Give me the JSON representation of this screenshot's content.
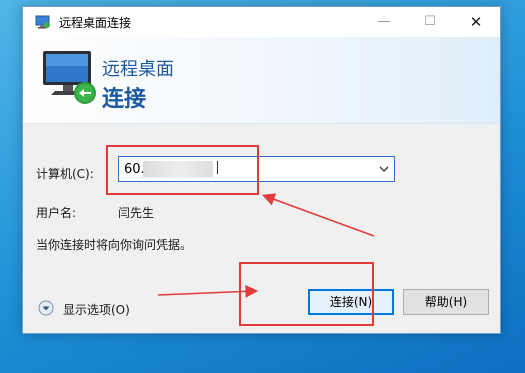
{
  "window": {
    "title": "远程桌面连接",
    "minimize_glyph": "—",
    "maximize_glyph": "☐",
    "close_glyph": "✕"
  },
  "banner": {
    "line1": "远程桌面",
    "line2": "连接"
  },
  "form": {
    "computer_label": "计算机(C):",
    "computer_value": "60.",
    "username_label": "用户名:",
    "username_value": "闫先生",
    "message": "当你连接时将向你询问凭据。"
  },
  "options_toggle": {
    "label": "显示选项(O)",
    "icon": "chevron-down-circle-icon"
  },
  "buttons": {
    "connect_label": "连接(N)",
    "help_label": "帮助(H)"
  },
  "colors": {
    "accent": "#0078d7",
    "banner_text": "#1c5aa0",
    "annotation": "#e33a3a"
  }
}
